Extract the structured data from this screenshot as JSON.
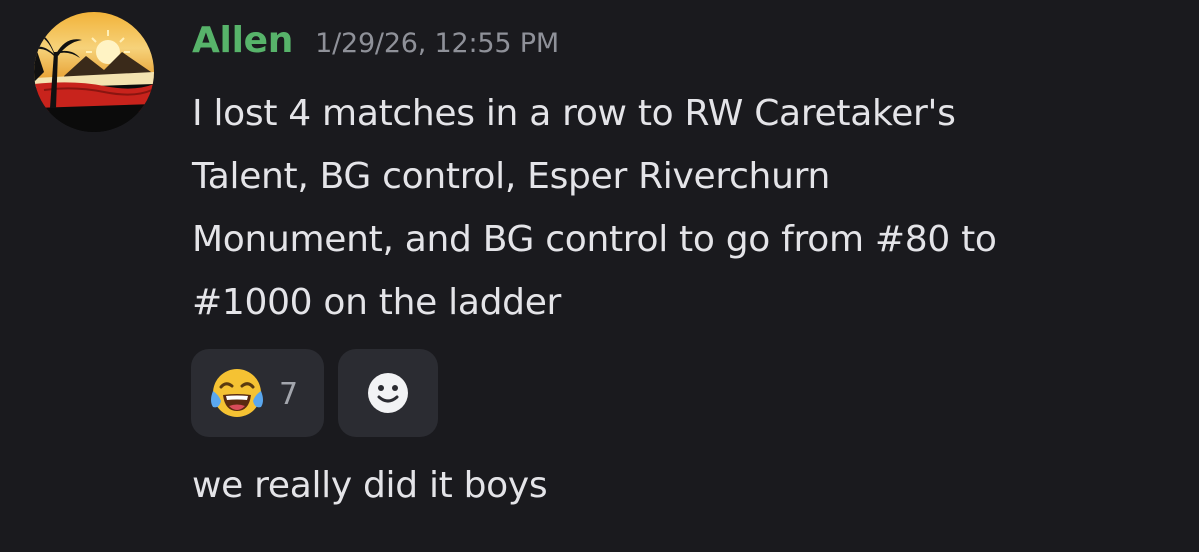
{
  "message": {
    "username": "Allen",
    "username_color": "#57b36a",
    "timestamp": "1/29/26, 12:55 PM",
    "content_lines": [
      "I lost 4 matches in a row to RW Caretaker's",
      "Talent, BG control, Esper Riverchurn",
      "Monument, and BG control to go from #80 to",
      "#1000 on the ladder"
    ],
    "reactions": [
      {
        "emoji": "joy-emoji",
        "count": "7"
      }
    ],
    "add_reaction_icon": "smiley-add-reaction-icon",
    "followup": "we really did it boys"
  },
  "theme": {
    "background": "#1a1a1e",
    "text": "#e4e4e8",
    "muted": "#8f9199",
    "reaction_bg": "#2b2c32"
  }
}
